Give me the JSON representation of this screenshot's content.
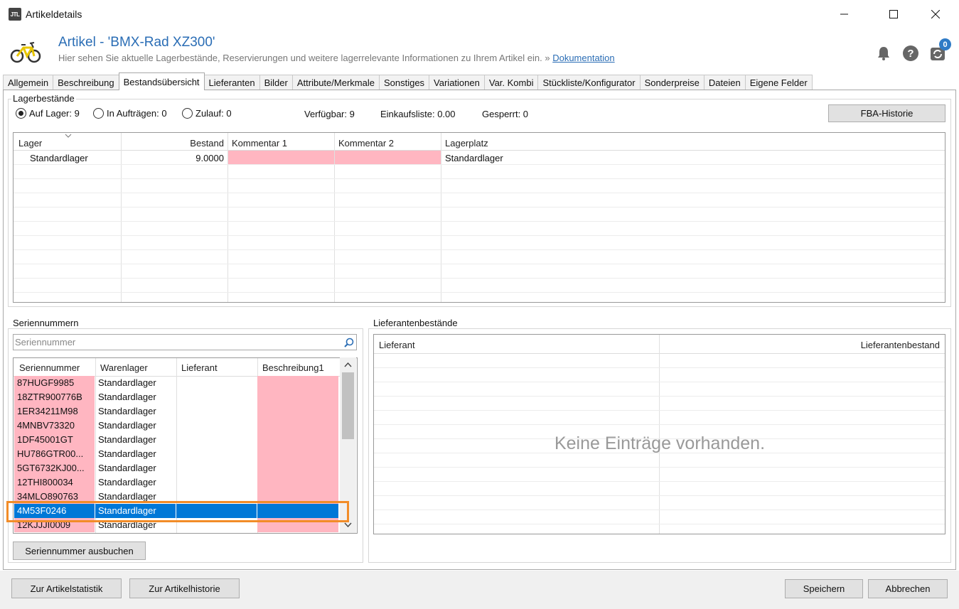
{
  "window": {
    "title": "Artikeldetails",
    "app_icon": "JTL"
  },
  "header": {
    "title": "Artikel - 'BMX-Rad XZ300'",
    "subtitle": "Hier sehen Sie aktuelle Lagerbestände, Reservierungen und weitere lagerrelevante Informationen zu Ihrem Artikel ein. »",
    "doc_link": "Dokumentation",
    "notification_count": "0"
  },
  "tabs": [
    {
      "label": "Allgemein"
    },
    {
      "label": "Beschreibung"
    },
    {
      "label": "Bestandsübersicht",
      "active": true
    },
    {
      "label": "Lieferanten"
    },
    {
      "label": "Bilder"
    },
    {
      "label": "Attribute/Merkmale"
    },
    {
      "label": "Sonstiges"
    },
    {
      "label": "Variationen"
    },
    {
      "label": "Var. Kombi"
    },
    {
      "label": "Stückliste/Konfigurator"
    },
    {
      "label": "Sonderpreise"
    },
    {
      "label": "Dateien"
    },
    {
      "label": "Eigene Felder"
    }
  ],
  "lager": {
    "group_label": "Lagerbestände",
    "radios": [
      {
        "label": "Auf Lager: 9",
        "checked": true
      },
      {
        "label": "In Aufträgen: 0",
        "checked": false
      },
      {
        "label": "Zulauf: 0",
        "checked": false
      }
    ],
    "verfuegbar": "Verfügbar: 9",
    "einkaufsliste": "Einkaufsliste: 0.00",
    "gesperrt": "Gesperrt: 0",
    "fba_button": "FBA-Historie",
    "columns": [
      "Lager",
      "Bestand",
      "Kommentar 1",
      "Kommentar 2",
      "Lagerplatz"
    ],
    "rows": [
      {
        "lager": "Standardlager",
        "bestand": "9.0000",
        "kommentar1": "",
        "kommentar2": "",
        "lagerplatz": "Standardlager"
      }
    ]
  },
  "serien": {
    "group_label": "Seriennummern",
    "search_placeholder": "Seriennummer",
    "columns": [
      "Seriennummer",
      "Warenlager",
      "Lieferant",
      "Beschreibung1"
    ],
    "rows": [
      {
        "nr": "87HUGF9985",
        "lager": "Standardlager",
        "lieferant": "",
        "beschreibung": ""
      },
      {
        "nr": "18ZTR900776B",
        "lager": "Standardlager",
        "lieferant": "",
        "beschreibung": ""
      },
      {
        "nr": "1ER34211M98",
        "lager": "Standardlager",
        "lieferant": "",
        "beschreibung": ""
      },
      {
        "nr": "4MNBV73320",
        "lager": "Standardlager",
        "lieferant": "",
        "beschreibung": ""
      },
      {
        "nr": "1DF45001GT",
        "lager": "Standardlager",
        "lieferant": "",
        "beschreibung": ""
      },
      {
        "nr": "HU786GTR00...",
        "lager": "Standardlager",
        "lieferant": "",
        "beschreibung": ""
      },
      {
        "nr": "5GT6732KJ00...",
        "lager": "Standardlager",
        "lieferant": "",
        "beschreibung": ""
      },
      {
        "nr": "12THI800034",
        "lager": "Standardlager",
        "lieferant": "",
        "beschreibung": ""
      },
      {
        "nr": "34MLO890763",
        "lager": "Standardlager",
        "lieferant": "",
        "beschreibung": ""
      },
      {
        "nr": "4M53F0246",
        "lager": "Standardlager",
        "lieferant": "",
        "beschreibung": "",
        "selected": true
      },
      {
        "nr": "12KJJJI0009",
        "lager": "Standardlager",
        "lieferant": "",
        "beschreibung": ""
      }
    ],
    "book_button": "Seriennummer ausbuchen"
  },
  "lieferantenbestaende": {
    "group_label": "Lieferantenbestände",
    "columns": [
      "Lieferant",
      "Lieferantenbestand"
    ],
    "empty_message": "Keine Einträge vorhanden."
  },
  "footer": {
    "statistik_button": "Zur Artikelstatistik",
    "historie_button": "Zur Artikelhistorie",
    "save_button": "Speichern",
    "cancel_button": "Abbrechen"
  },
  "colors": {
    "accent": "#2a6db5",
    "selection": "#0078d7",
    "warning_cell": "#ffb6c1",
    "highlight_frame": "#f28c28"
  }
}
